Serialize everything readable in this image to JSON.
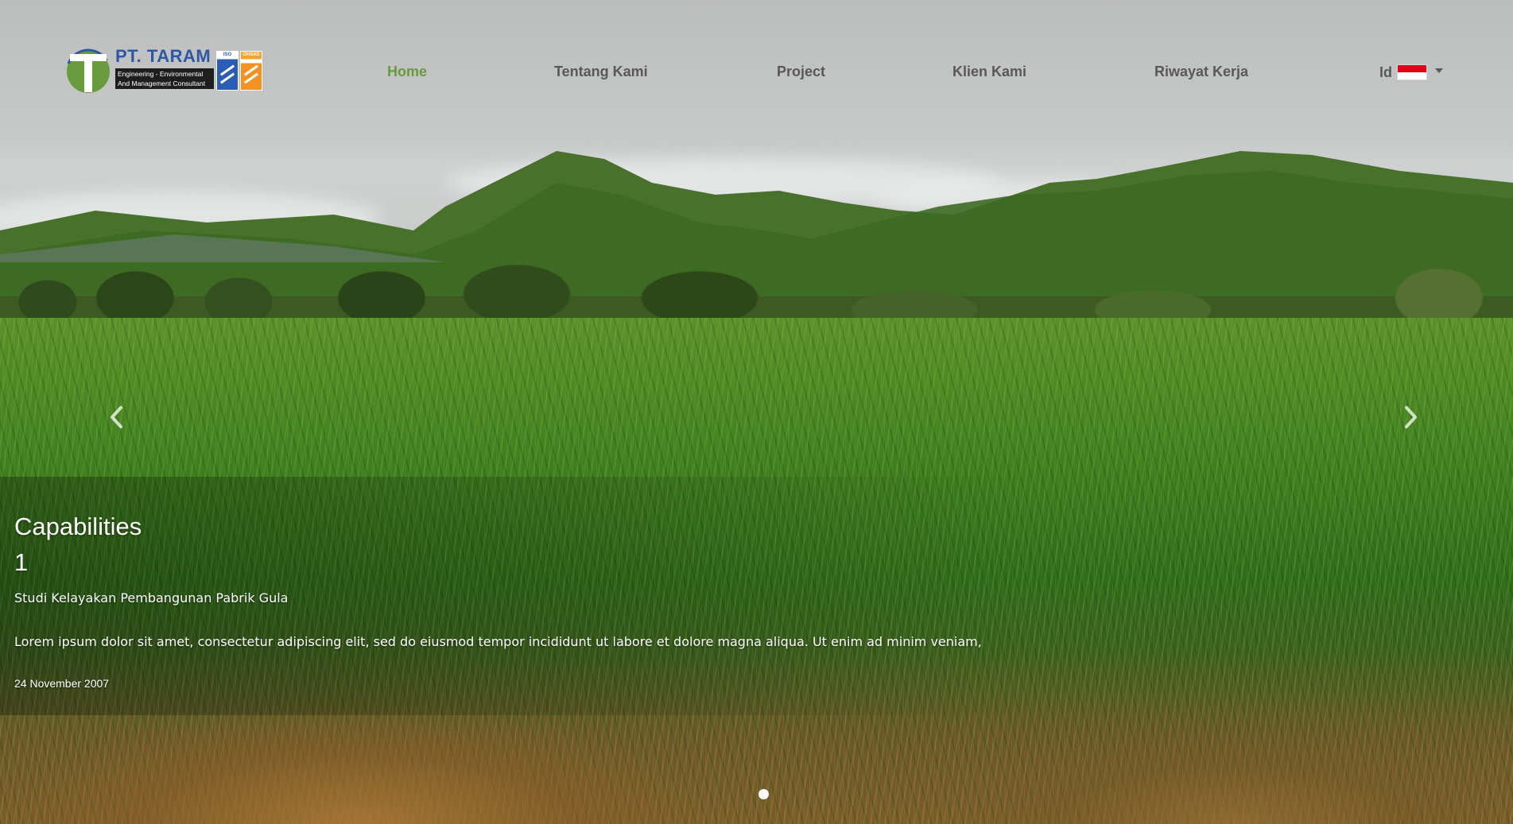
{
  "brand": {
    "name": "PT. TARAM",
    "tagline_line1": "Engineering - Environmental",
    "tagline_line2": "And Management Consultant",
    "cert1_label": "ISO",
    "cert2_label": "OHSAS"
  },
  "nav": {
    "items": [
      {
        "label": "Home",
        "active": true
      },
      {
        "label": "Tentang Kami",
        "active": false
      },
      {
        "label": "Project",
        "active": false
      },
      {
        "label": "Klien Kami",
        "active": false
      },
      {
        "label": "Riwayat Kerja",
        "active": false
      }
    ],
    "language": {
      "label": "Id",
      "flag": "indonesia-flag"
    }
  },
  "hero": {
    "title_line1": "Capabilities",
    "title_line2": "1",
    "subtitle": "Studi Kelayakan Pembangunan Pabrik Gula",
    "body": "Lorem ipsum dolor sit amet, consectetur adipiscing elit, sed do eiusmod tempor incididunt ut labore et dolore magna aliqua. Ut enim ad minim veniam,",
    "date": "24 November 2007"
  },
  "carousel": {
    "slide_count": 1,
    "active_index": 0,
    "prev_icon": "chevron-left-icon",
    "next_icon": "chevron-right-icon"
  },
  "colors": {
    "nav_active": "#6a9a3e",
    "nav_text": "#585858",
    "brand_blue": "#2f57a6",
    "brand_green": "#6a9a3e"
  }
}
